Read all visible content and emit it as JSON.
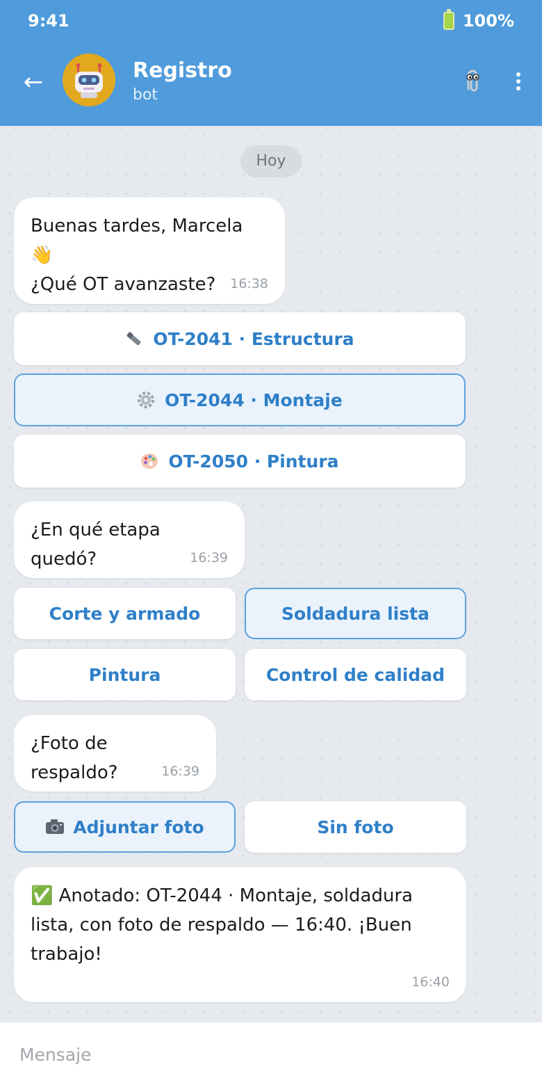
{
  "status_bar": {
    "time": "9:41",
    "battery": "100%"
  },
  "header": {
    "title": "Registro",
    "subtitle": "bot"
  },
  "chat": {
    "day_label": "Hoy",
    "messages": [
      {
        "text": "Buenas tardes, Marcela 👋\n¿Qué OT avanzaste?",
        "time": "16:38"
      },
      {
        "text": "¿En qué etapa quedó?",
        "time": "16:39"
      },
      {
        "text": "¿Foto de respaldo?",
        "time": "16:39"
      },
      {
        "text": "✅ Anotado: OT-2044 · Montaje, soldadura\nlista, con foto de respaldo — 16:40. ¡Buen\ntrabajo!",
        "time": "16:40"
      }
    ],
    "ot_options": [
      {
        "label": "OT-2041 · Estructura",
        "icon": "wrench-icon",
        "selected": false
      },
      {
        "label": "OT-2044 · Montaje",
        "icon": "gear-icon",
        "selected": true
      },
      {
        "label": "OT-2050 · Pintura",
        "icon": "palette-icon",
        "selected": false
      }
    ],
    "stage_options": [
      {
        "label": "Corte y armado",
        "selected": false
      },
      {
        "label": "Soldadura lista",
        "selected": true
      },
      {
        "label": "Pintura",
        "selected": false
      },
      {
        "label": "Control de calidad",
        "selected": false
      }
    ],
    "photo_options": [
      {
        "label": "Adjuntar foto",
        "icon": "camera-icon",
        "selected": true
      },
      {
        "label": "Sin foto",
        "selected": false
      }
    ]
  },
  "composer": {
    "placeholder": "Mensaje"
  },
  "colors": {
    "header": "#4f9bdb",
    "accent": "#2f7fc8",
    "selected_bg": "#eaf3fc",
    "selected_border": "#5aa1de",
    "chat_bg": "#e6e9ee"
  }
}
